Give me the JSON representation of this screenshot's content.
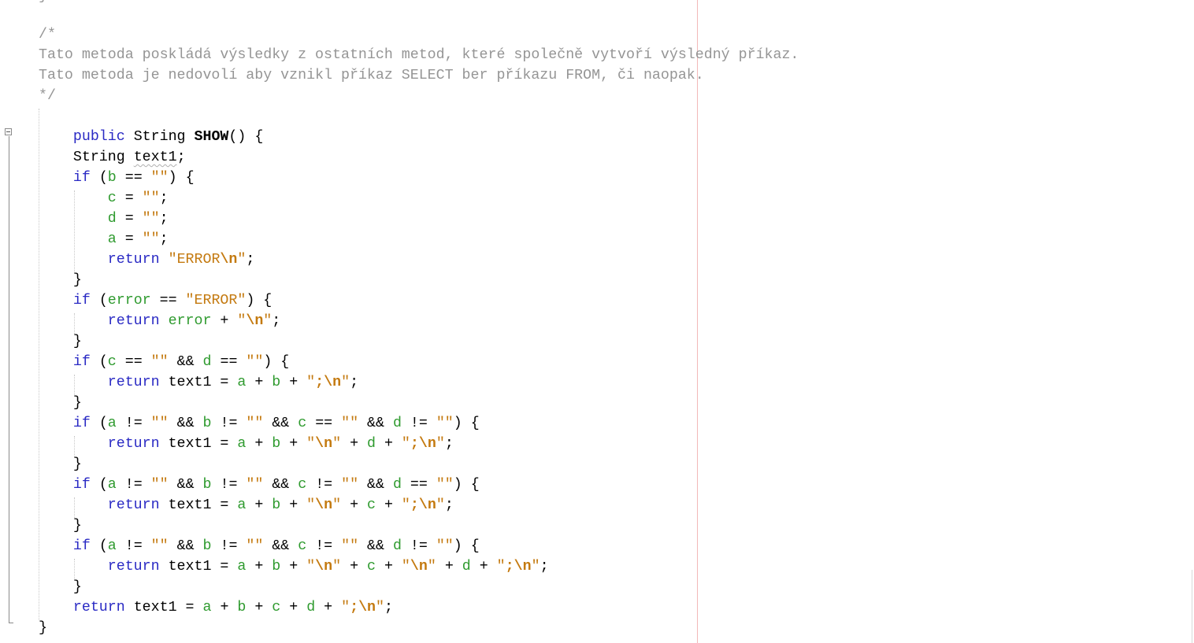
{
  "editor": {
    "comment": {
      "open": "/*",
      "line1": "Tato metoda poskládá výsledky z ostatních metod, které společně vytvoří výsledný příkaz.",
      "line2": "Tato metoda je nedovolí aby vznikl příkaz SELECT ber příkazu FROM, či naopak.",
      "close": "*/"
    },
    "code": {
      "kw_public": "public",
      "kw_if": "if",
      "kw_return": "return",
      "type_string": "String",
      "method_name": "SHOW",
      "var_text1": "text1",
      "var_a": "a",
      "var_b": "b",
      "var_c": "c",
      "var_d": "d",
      "var_error": "error",
      "empty_str": "\"\"",
      "str_error_lit": "\"ERROR\"",
      "esc_n": "\\n",
      "semi_n": ";\\n",
      "quote": "\"",
      "str_error_text": "ERROR"
    }
  }
}
